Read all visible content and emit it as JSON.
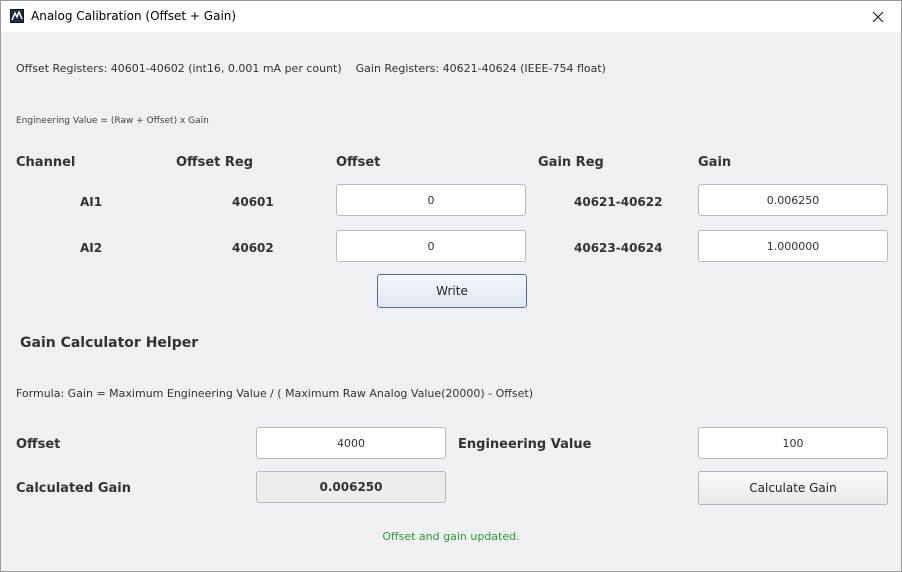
{
  "window": {
    "title": "Analog Calibration (Offset + Gain)",
    "app_icon": "app-icon",
    "close_icon": "close-icon"
  },
  "info": {
    "registers": "Offset Registers: 40601-40602 (int16, 0.001 mA per count)    Gain Registers: 40621-40624 (IEEE-754 float)",
    "formula_note": "Engineering Value = (Raw + Offset) x Gain"
  },
  "table": {
    "headers": {
      "channel": "Channel",
      "offset_reg": "Offset Reg",
      "offset": "Offset",
      "gain_reg": "Gain Reg",
      "gain": "Gain"
    },
    "rows": [
      {
        "channel": "AI1",
        "offset_reg": "40601",
        "offset": "0",
        "gain_reg": "40621-40622",
        "gain": "0.006250"
      },
      {
        "channel": "AI2",
        "offset_reg": "40602",
        "offset": "0",
        "gain_reg": "40623-40624",
        "gain": "1.000000"
      }
    ],
    "write_label": "Write"
  },
  "calculator": {
    "title": "Gain Calculator Helper",
    "formula": "Formula: Gain = Maximum Engineering Value / ( Maximum Raw Analog Value(20000) - Offset)",
    "offset_label": "Offset",
    "offset_value": "4000",
    "eng_label": "Engineering Value",
    "eng_value": "100",
    "calc_gain_label": "Calculated Gain",
    "calc_gain_value": "0.006250",
    "button_label": "Calculate Gain"
  },
  "status": {
    "message": "Offset and gain updated.",
    "color": "#2a9a2a"
  }
}
